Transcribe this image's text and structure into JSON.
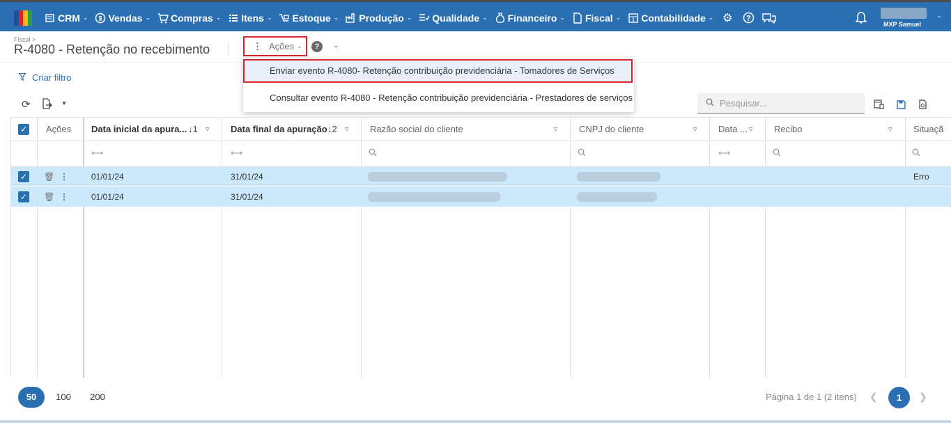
{
  "nav": {
    "items": [
      {
        "label": "CRM",
        "icon": "crm-icon"
      },
      {
        "label": "Vendas",
        "icon": "dollar-icon"
      },
      {
        "label": "Compras",
        "icon": "cart-icon"
      },
      {
        "label": "Itens",
        "icon": "items-icon"
      },
      {
        "label": "Estoque",
        "icon": "stock-icon"
      },
      {
        "label": "Produção",
        "icon": "factory-icon"
      },
      {
        "label": "Qualidade",
        "icon": "quality-icon"
      },
      {
        "label": "Financeiro",
        "icon": "money-bag-icon"
      },
      {
        "label": "Fiscal",
        "icon": "document-icon"
      },
      {
        "label": "Contabilidade",
        "icon": "calculator-icon"
      }
    ],
    "user_name": "MXP Samuel"
  },
  "page": {
    "breadcrumb": "Fiscal >",
    "title": "R-4080 - Retenção no recebimento",
    "actions_label": "Ações"
  },
  "actions_menu": {
    "item1": "Enviar evento R-4080- Retenção contribuição previdenciária - Tomadores de Serviços",
    "item2": "Consultar evento R-4080 - Retenção contribuição previdenciária - Prestadores de serviços"
  },
  "toolbar": {
    "create_filter": "Criar filtro",
    "search_placeholder": "Pesquisar..."
  },
  "table": {
    "headers": {
      "actions": "Ações",
      "start_date": "Data inicial da apura...",
      "start_sort": "↓1",
      "end_date": "Data final da apuração",
      "end_sort": "↓2",
      "company": "Razão social do cliente",
      "cnpj": "CNPJ do cliente",
      "date": "Data ...",
      "receipt": "Recibo",
      "status": "Situaçã"
    },
    "rows": [
      {
        "start": "01/01/24",
        "end": "31/01/24",
        "status": "Erro"
      },
      {
        "start": "01/01/24",
        "end": "31/01/24",
        "status": ""
      }
    ]
  },
  "pagination": {
    "sizes": [
      "50",
      "100",
      "200"
    ],
    "info": "Página 1 de 1 (2 itens)",
    "current": "1"
  },
  "colors": {
    "header_bg": "#2a6fb1",
    "row_selected": "#cce8fb",
    "highlight_border": "#d9262c"
  }
}
